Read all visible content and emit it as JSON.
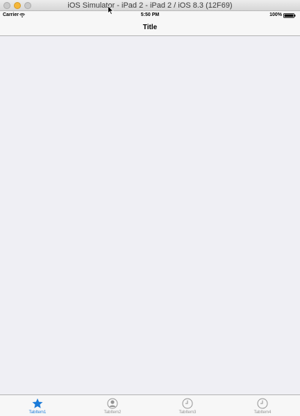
{
  "window": {
    "title": "iOS Simulator - iPad 2 - iPad 2 / iOS 8.3 (12F69)"
  },
  "status_bar": {
    "carrier": "Carrier",
    "time": "5:50 PM",
    "battery": "100%"
  },
  "nav_bar": {
    "title": "Title"
  },
  "tab_bar": {
    "selected_color": "#1a7ad8",
    "unselected_color": "#929292",
    "items": [
      {
        "label": "TabItem1",
        "icon": "star-icon",
        "selected": true
      },
      {
        "label": "TabItem2",
        "icon": "contact-icon",
        "selected": false
      },
      {
        "label": "TabItem3",
        "icon": "clock-icon",
        "selected": false
      },
      {
        "label": "TabItem4",
        "icon": "clock-icon",
        "selected": false
      }
    ]
  }
}
